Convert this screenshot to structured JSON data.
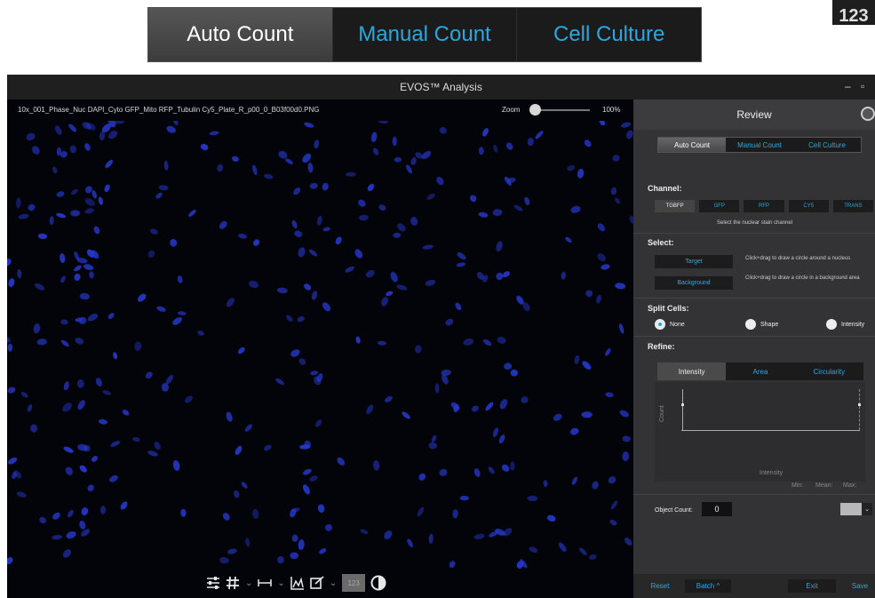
{
  "callout": {
    "tabs": [
      "Auto Count",
      "Manual Count",
      "Cell Culture"
    ],
    "badge": "123"
  },
  "window": {
    "title": "EVOS™ Analysis",
    "minimize": "–",
    "restore": "▫"
  },
  "viewer": {
    "filename": "10x_001_Phase_Nuc DAPI_Cyto GFP_Mito RFP_Tubulin Cy5_Plate_R_p00_0_B03f00d0.PNG",
    "zoom_label": "Zoom",
    "zoom_value": "100%",
    "zoom_level": 0.0,
    "tools": {
      "tool_123": "123"
    }
  },
  "panel": {
    "title": "Review",
    "tabs": [
      "Auto Count",
      "Manual Count",
      "Cell Culture"
    ],
    "channel": {
      "title": "Channel:",
      "buttons": [
        "TGBFP",
        "GFP",
        "RFP",
        "CY5",
        "TRANS"
      ],
      "hint": "Select the nuclear stain channel"
    },
    "select": {
      "title": "Select:",
      "target_label": "Target",
      "target_hint": "Click+drag to draw a circle around a nucleus",
      "background_label": "Background",
      "background_hint": "Click+drag to draw a circle in a background area"
    },
    "split": {
      "title": "Split Cells:",
      "options": [
        "None",
        "Shape",
        "Intensity"
      ],
      "selected": "None"
    },
    "refine": {
      "title": "Refine:",
      "tabs": [
        "Intensity",
        "Area",
        "Circularity"
      ],
      "y_label": "Count",
      "x_label": "Intensity",
      "stats": [
        "Min:",
        "Mean:",
        "Max:"
      ]
    },
    "object_count": {
      "label": "Object Count:",
      "value": "0"
    },
    "footer": {
      "reset": "Reset",
      "batch": "Batch ^",
      "exit": "Exit",
      "save": "Save"
    }
  },
  "colors": {
    "accent": "#29a8e0",
    "nucleus": "#2538c8",
    "panel_bg": "#333335"
  }
}
